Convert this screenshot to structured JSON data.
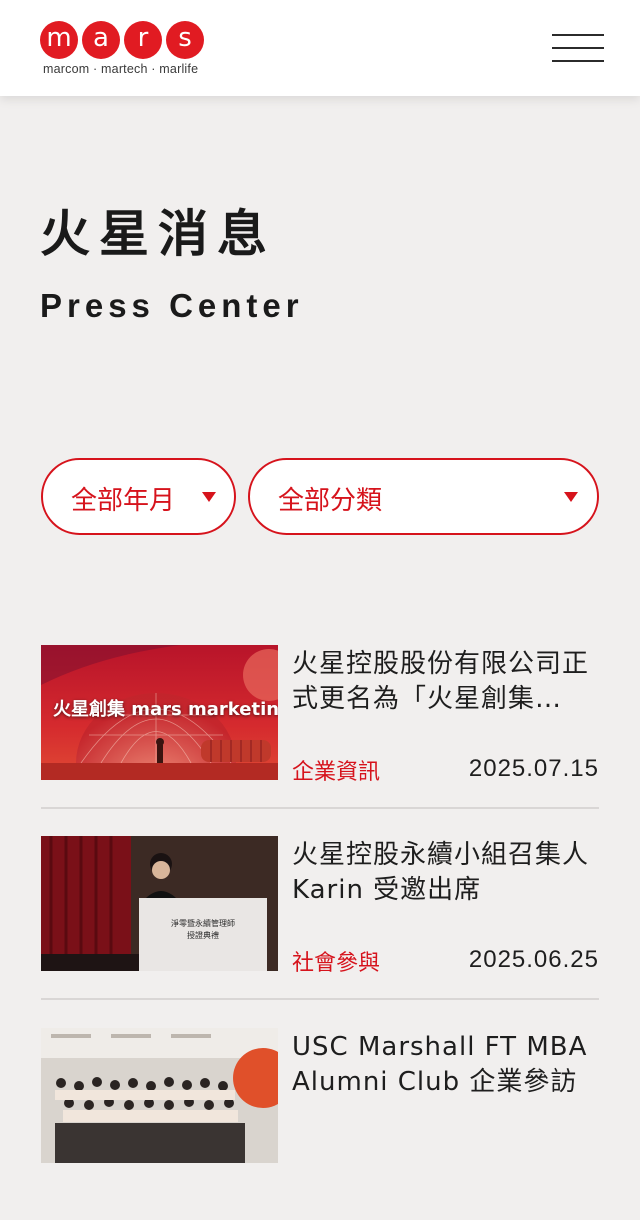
{
  "header": {
    "logo_letters": [
      "m",
      "a",
      "r",
      "s"
    ],
    "logo_tagline": "marcom · martech · marlife",
    "brand_color": "#e11b22",
    "menu_icon": "hamburger-icon"
  },
  "page": {
    "title": "火星消息",
    "subtitle": "Press Center"
  },
  "filters": {
    "year": {
      "selected": "全部年月"
    },
    "category": {
      "selected": "全部分類"
    },
    "accent_color": "#d6131c"
  },
  "news": [
    {
      "title": "火星控股股份有限公司正式更名為「火星創集 mars marketing」",
      "category": "企業資訊",
      "date": "2025.07.15",
      "thumb_caption": "火星創集 mars marketing"
    },
    {
      "title": "火星控股永續小組召集人 Karin 受邀出席",
      "category": "社會參與",
      "date": "2025.06.25",
      "thumb_caption": ""
    },
    {
      "title": "USC Marshall FT MBA Alumni Club 企業參訪",
      "category": "",
      "date": "",
      "thumb_caption": ""
    }
  ]
}
